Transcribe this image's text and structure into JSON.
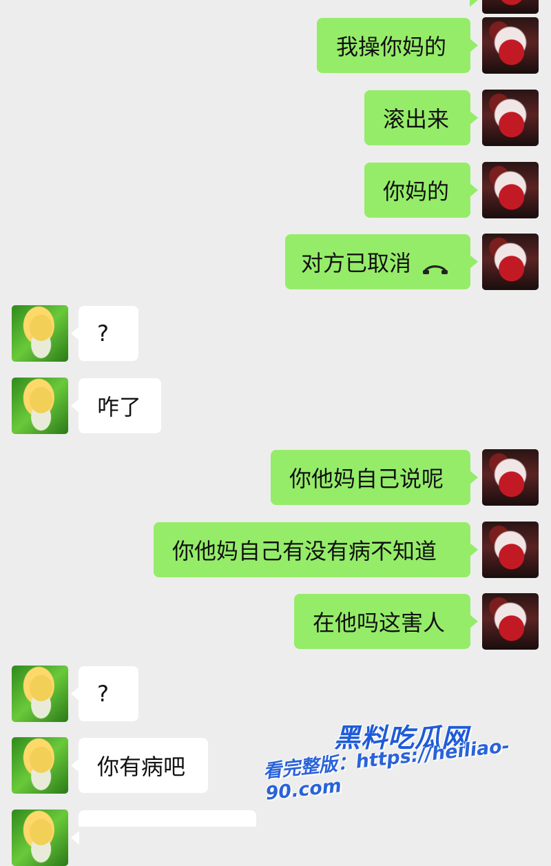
{
  "messages": [
    {
      "side": "me",
      "text": "我操你妈的"
    },
    {
      "side": "me",
      "text": "滚出来"
    },
    {
      "side": "me",
      "text": "你妈的"
    },
    {
      "side": "me",
      "text": "对方已取消",
      "icon": "phone-hangup-icon"
    },
    {
      "side": "them",
      "text": "?"
    },
    {
      "side": "them",
      "text": "咋了"
    },
    {
      "side": "me",
      "text": "你他妈自己说呢"
    },
    {
      "side": "me",
      "text": "你他妈自己有没有病不知道"
    },
    {
      "side": "me",
      "text": "在他吗这害人"
    },
    {
      "side": "them",
      "text": "?"
    },
    {
      "side": "them",
      "text": "你有病吧"
    }
  ],
  "watermark": {
    "title": "黑料吃瓜网",
    "url": "看完整版：https://heiliao-90.com"
  },
  "colors": {
    "background": "#ededed",
    "sent_bubble": "#95ec69",
    "received_bubble": "#ffffff",
    "watermark": "#1f5bd8"
  }
}
